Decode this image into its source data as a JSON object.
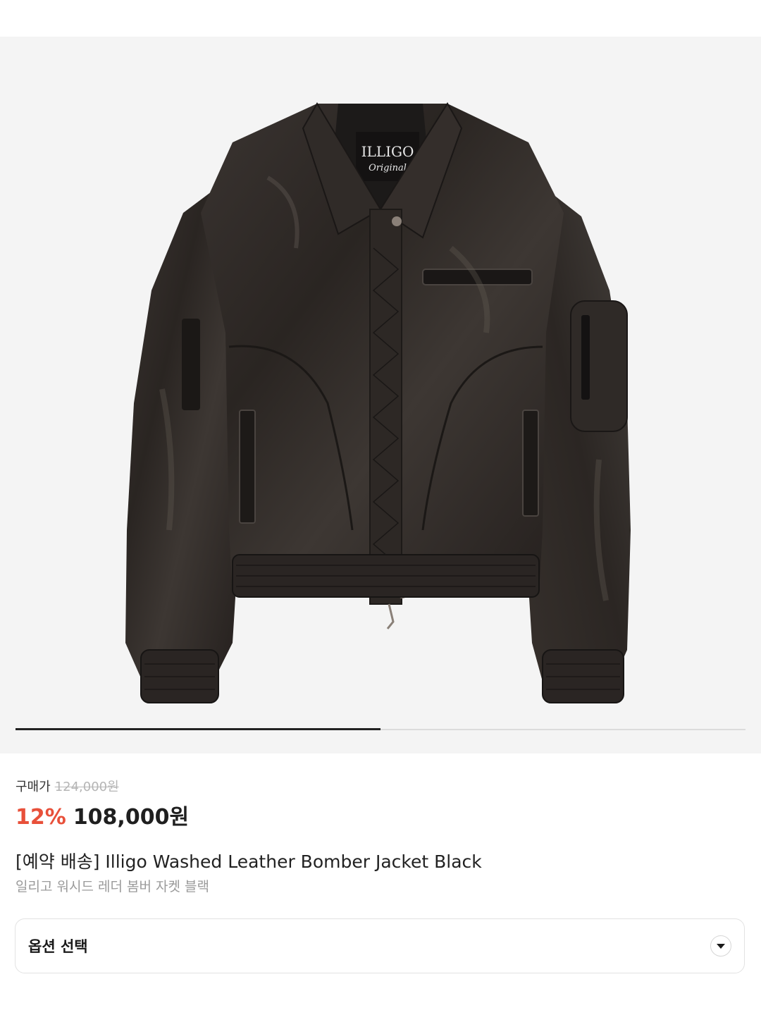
{
  "gallery": {
    "image_alt": "Illigo Washed Leather Bomber Jacket Black",
    "label_brand": "ILLIGO",
    "label_script": "Original",
    "current_index": 1,
    "total": 2,
    "background": "#f4f4f4"
  },
  "price": {
    "label": "구매가",
    "original": "124,000원",
    "discount": "12%",
    "sale": "108,000원",
    "discount_color": "#e8503a"
  },
  "product": {
    "title": "[예약 배송] Illigo Washed Leather Bomber Jacket Black",
    "subtitle": "일리고 워시드 레더 봄버 자켓 블랙"
  },
  "option": {
    "label": "옵션 선택",
    "icon": "chevron-down-icon"
  }
}
